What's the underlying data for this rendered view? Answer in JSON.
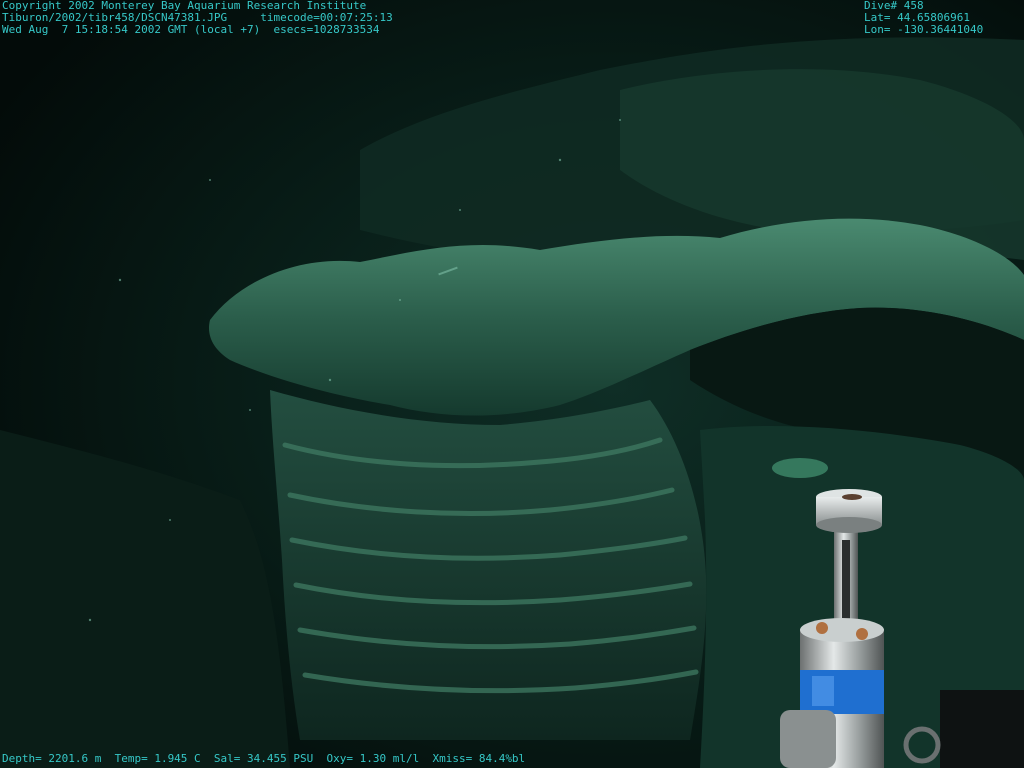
{
  "overlay": {
    "copyright": "Copyright 2002 Monterey Bay Aquarium Research Institute",
    "file_path": "Tiburon/2002/tibr458/DSCN47381.JPG",
    "timecode": "timecode=00:07:25:13",
    "datetime": "Wed Aug  7 15:18:54 2002 GMT (local +7)",
    "esecs": "esecs=1028733534",
    "dive": "Dive# 458",
    "lat": "Lat= 44.65806961",
    "lon": "Lon= -130.36441040",
    "sensors": "Depth= 2201.6 m  Temp= 1.945 C  Sal= 34.455 PSU  Oxy= 1.30 ml/l  Xmiss= 84.4%bl"
  },
  "colors": {
    "overlay_text": "#36c8c8",
    "water": "#051210",
    "rock": "#1d4a3c",
    "rock_highlight": "#3f7a62",
    "probe_band": "#1f6fd0"
  }
}
